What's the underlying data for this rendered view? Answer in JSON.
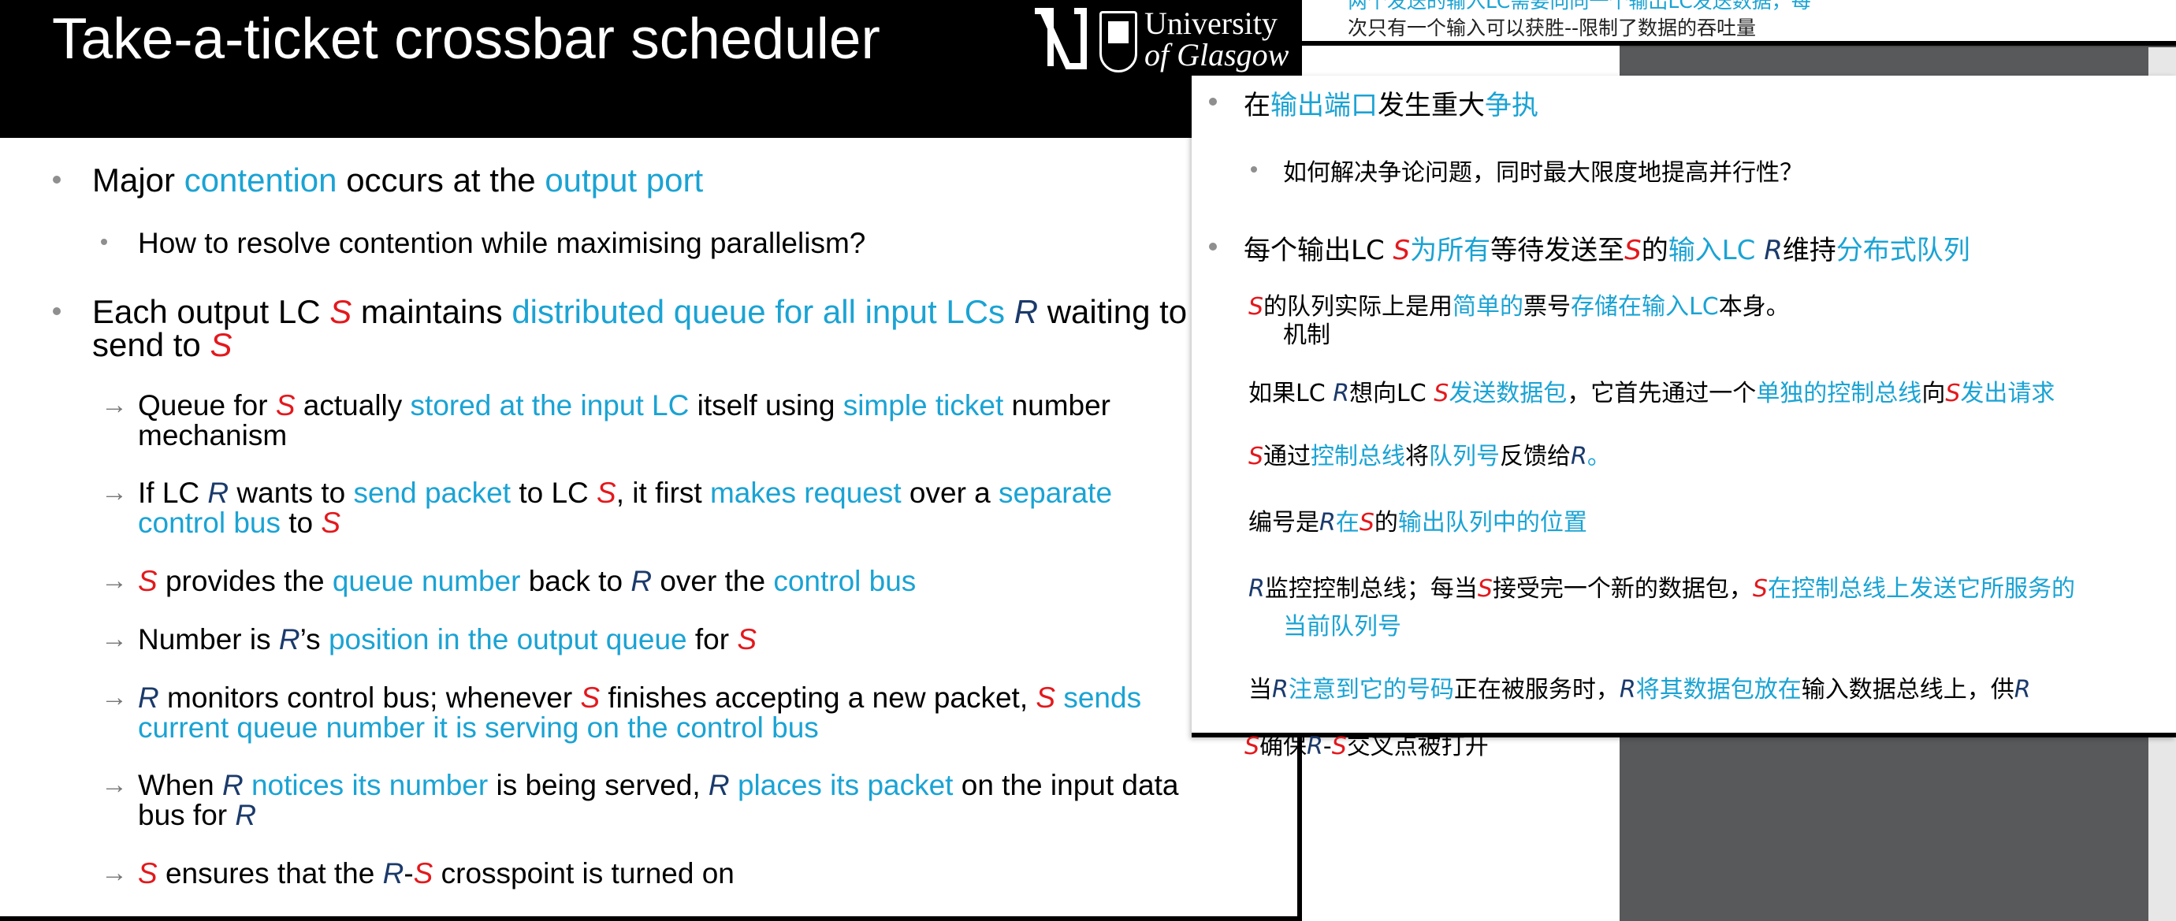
{
  "slide": {
    "title": "Take-a-ticket crossbar scheduler",
    "logo": {
      "line1": "University",
      "line2": "of Glasgow"
    },
    "bullets": [
      {
        "parts": [
          "Major ",
          "contention",
          " occurs at the ",
          "output port"
        ]
      },
      {
        "parts": [
          "How to resolve contention while maximising parallelism?"
        ]
      },
      {
        "parts": [
          "Each output LC ",
          "S",
          " maintains ",
          "distributed queue for all input LCs",
          " ",
          "R",
          " waiting to"
        ],
        "cont": [
          "send to ",
          "S"
        ]
      },
      {
        "parts": [
          "Queue for ",
          "S",
          " actually ",
          "stored at the input LC",
          " itself using ",
          "simple ticket",
          " number"
        ],
        "cont": [
          "mechanism"
        ]
      },
      {
        "parts": [
          "If LC ",
          "R",
          " wants to ",
          "send packet",
          " to LC ",
          "S",
          ", it first ",
          "makes request",
          " over a ",
          "separate"
        ],
        "cont": [
          "control bus",
          " to ",
          "S"
        ]
      },
      {
        "parts": [
          "S",
          " provides the ",
          "queue number",
          " back to ",
          "R",
          " over the ",
          "control bus"
        ]
      },
      {
        "parts": [
          "Number is ",
          "R",
          "’s ",
          "position in the output queue",
          " for ",
          "S"
        ]
      },
      {
        "parts": [
          "R",
          " monitors control bus; whenever ",
          "S",
          " finishes accepting a new packet, ",
          "S",
          " sends"
        ],
        "cont": [
          "current queue number it is serving on the control bus"
        ]
      },
      {
        "parts": [
          "When ",
          "R",
          " ",
          "notices its number",
          " is being served, ",
          "R",
          " ",
          "places its packet",
          " on the input data"
        ],
        "cont": [
          "bus for ",
          "R"
        ]
      },
      {
        "parts": [
          "S",
          " ensures that the ",
          "R",
          "-",
          "S",
          " crosspoint is turned on"
        ]
      }
    ]
  },
  "back_strip": {
    "line1": "两个发送的输入LC需要向同一个输出LC发送数据，每",
    "line2": "次只有一个输入可以获胜--限制了数据的吞吐量"
  },
  "translation": {
    "bullets": [
      {
        "parts": [
          "在",
          "输出端口",
          "发生重大",
          "争执"
        ]
      },
      {
        "parts": [
          "如何解决争论问题，同时最大限度地提高并行性？"
        ]
      },
      {
        "parts": [
          "每个输出LC ",
          "S",
          "为所有",
          "等待发送至",
          "S",
          "的",
          "输入LC ",
          "R",
          "维持",
          "分布式队列"
        ]
      },
      {
        "parts": [
          "S",
          "的队列实际上是用",
          "简单的",
          "票号",
          "存储在输入LC",
          "本身。"
        ],
        "cont": [
          "机制"
        ]
      },
      {
        "parts": [
          "如果LC ",
          "R",
          "想向LC ",
          "S",
          "发送数据包",
          "，它首先通过一个",
          "单独的控制总线",
          "向",
          "S",
          "发出请求"
        ]
      },
      {
        "parts": [
          "S",
          "通过",
          "控制总线",
          "将",
          "队列号",
          "反馈给",
          "R",
          "。"
        ]
      },
      {
        "parts": [
          "编号是",
          "R",
          "在",
          "S",
          "的",
          "输出队列中的位置"
        ]
      },
      {
        "parts": [
          "R",
          "监控控制总线；每当",
          "S",
          "接受完一个新的数据包，",
          "S",
          "在控制总线上发送它所服务的"
        ],
        "cont": [
          "当前队列号"
        ]
      },
      {
        "parts": [
          "当",
          "R",
          "注意到它的号码",
          "正在被服务时，",
          "R",
          "将其数据包放在",
          "输入数据总线上，供",
          "R"
        ]
      },
      {
        "parts": [
          "S",
          "确保",
          "R",
          "-",
          "S",
          "交叉点被打开"
        ]
      }
    ]
  },
  "colors": {
    "red_var": "#e4181c",
    "blue_var": "#1b3a6b",
    "accent": "#1aa3d4",
    "bullet": "#8f8f8f"
  }
}
